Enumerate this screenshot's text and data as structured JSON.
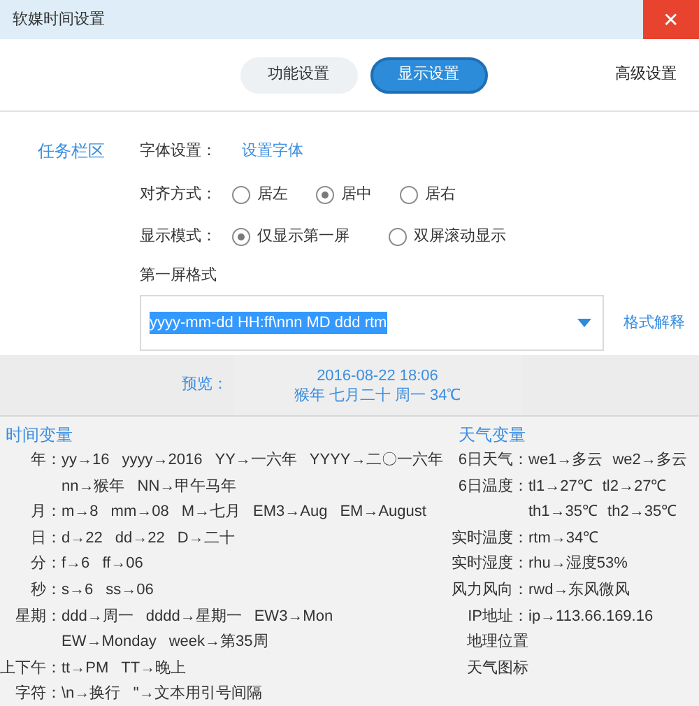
{
  "window": {
    "title": "软媒时间设置",
    "close": "✕"
  },
  "tabs": [
    {
      "label": "功能设置",
      "kind": "pill",
      "selected": false
    },
    {
      "label": "显示设置",
      "kind": "pill",
      "selected": true
    },
    {
      "label": "高级设置",
      "kind": "plain",
      "selected": false
    }
  ],
  "section_label": "任务栏区",
  "font_setting": {
    "label": "字体设置：",
    "link": "设置字体"
  },
  "alignment": {
    "label": "对齐方式：",
    "options": [
      {
        "label": "居左",
        "selected": false
      },
      {
        "label": "居中",
        "selected": true
      },
      {
        "label": "居右",
        "selected": false
      }
    ]
  },
  "display_mode": {
    "label": "显示模式：",
    "options": [
      {
        "label": "仅显示第一屏",
        "selected": true
      },
      {
        "label": "双屏滚动显示",
        "selected": false
      }
    ]
  },
  "format": {
    "label": "第一屏格式",
    "value": "yyyy-mm-dd HH:ff\\nnn MD ddd rtm",
    "text_selected": true,
    "help_link": "格式解释"
  },
  "preview": {
    "label": "预览：",
    "lines": [
      "2016-08-22 18:06",
      "猴年 七月二十 周一 34℃"
    ]
  },
  "time_vars": {
    "title": "时间变量",
    "rows": [
      {
        "label": "年：",
        "lines": [
          [
            "yy→16",
            "yyyy→2016",
            "YY→一六年",
            "YYYY→二〇一六年"
          ],
          [
            "nn→猴年",
            "NN→甲午马年"
          ]
        ]
      },
      {
        "label": "月：",
        "lines": [
          [
            "m→8",
            "mm→08",
            "M→七月",
            "EM3→Aug",
            "EM→August"
          ]
        ]
      },
      {
        "label": "日：",
        "lines": [
          [
            "d→22",
            "dd→22",
            "D→二十"
          ]
        ]
      },
      {
        "label": "分：",
        "lines": [
          [
            "f→6",
            "ff→06"
          ]
        ]
      },
      {
        "label": "秒：",
        "lines": [
          [
            "s→6",
            "ss→06"
          ]
        ]
      },
      {
        "label": "星期：",
        "lines": [
          [
            "ddd→周一",
            "dddd→星期一",
            "EW3→Mon"
          ],
          [
            "EW→Monday",
            "week→第35周"
          ]
        ]
      },
      {
        "label": "上下午：",
        "lines": [
          [
            "tt→PM",
            "TT→晚上"
          ]
        ]
      },
      {
        "label": "字符：",
        "lines": [
          [
            "\\n→换行",
            "''→文本用引号间隔"
          ]
        ]
      }
    ]
  },
  "weather_vars": {
    "title": "天气变量",
    "rows": [
      {
        "label": "6日天气：",
        "lines": [
          [
            "we1→多云",
            "we2→多云"
          ]
        ]
      },
      {
        "label": "6日温度：",
        "lines": [
          [
            "tl1→27℃",
            "tl2→27℃"
          ],
          [
            "th1→35℃",
            "th2→35℃"
          ]
        ]
      },
      {
        "label": "实时温度：",
        "lines": [
          [
            "rtm→34℃"
          ]
        ]
      },
      {
        "label": "实时湿度：",
        "lines": [
          [
            "rhu→湿度53%"
          ]
        ]
      },
      {
        "label": "风力风向：",
        "lines": [
          [
            "rwd→东风微风"
          ]
        ]
      },
      {
        "label": "IP地址：",
        "lines": [
          [
            "ip→113.66.169.16"
          ]
        ]
      },
      {
        "label": "地理位置",
        "lines": []
      },
      {
        "label": "天气图标",
        "lines": []
      }
    ]
  }
}
